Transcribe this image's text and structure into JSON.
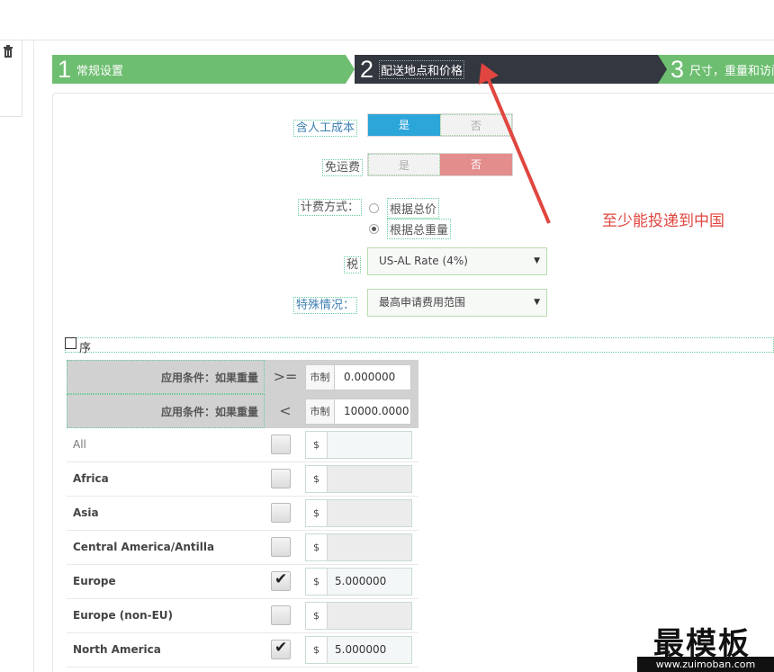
{
  "wizard": {
    "steps": [
      {
        "num": "1",
        "label": "常规设置"
      },
      {
        "num": "2",
        "label": "配送地点和价格"
      },
      {
        "num": "3",
        "label": "尺寸，重量和访问"
      }
    ]
  },
  "form": {
    "labor_cost": {
      "label": "含人工成本",
      "yes": "是",
      "no": "否"
    },
    "free_shipping": {
      "label": "免运费",
      "yes": "是",
      "no": "否"
    },
    "billing": {
      "label": "计费方式：",
      "options": [
        "根据总价",
        "根据总重量"
      ]
    },
    "tax": {
      "label": "税",
      "value": "US-AL Rate (4%)"
    },
    "special": {
      "label": "特殊情况：",
      "value": "最高申请费用范围"
    }
  },
  "annotation": "至少能投递到中国",
  "sort_label": "序",
  "conditions": [
    {
      "label": "应用条件：如果重量",
      "op": ">=",
      "unit": "市制",
      "value": "0.000000"
    },
    {
      "label": "应用条件：如果重量",
      "op": "<",
      "unit": "市制",
      "value": "10000.0000"
    }
  ],
  "zones": [
    {
      "name": "All",
      "checked": false,
      "currency": "$",
      "amount": ""
    },
    {
      "name": "Africa",
      "checked": false,
      "currency": "$",
      "amount": ""
    },
    {
      "name": "Asia",
      "checked": false,
      "currency": "$",
      "amount": ""
    },
    {
      "name": "Central America/Antilla",
      "checked": false,
      "currency": "$",
      "amount": ""
    },
    {
      "name": "Europe",
      "checked": true,
      "currency": "$",
      "amount": "5.000000"
    },
    {
      "name": "Europe (non-EU)",
      "checked": false,
      "currency": "$",
      "amount": ""
    },
    {
      "name": "North America",
      "checked": true,
      "currency": "$",
      "amount": "5.000000"
    }
  ],
  "watermark": {
    "big": "最模板",
    "small": "www.zuimoban.com"
  },
  "colors": {
    "green": "#6dbe70",
    "dark": "#33373f",
    "blue": "#2ca5d9",
    "red": "#e38d8d",
    "note": "#e0463f"
  }
}
